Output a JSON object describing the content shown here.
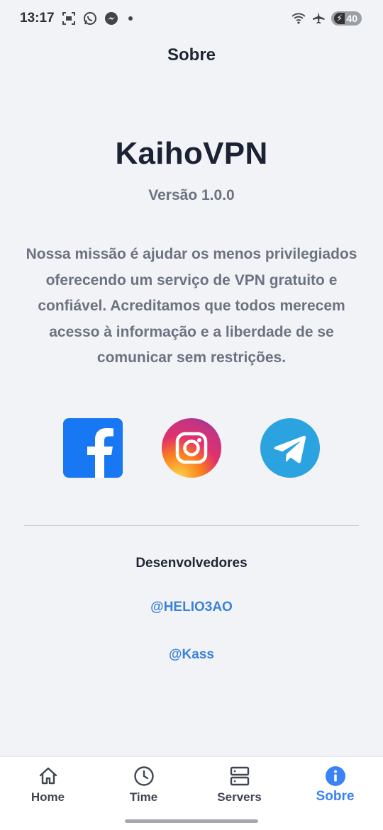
{
  "status_bar": {
    "time": "13:17",
    "battery": "40",
    "icons": [
      "screenshot-icon",
      "whatsapp-icon",
      "messenger-icon",
      "wifi-icon",
      "airplane-icon",
      "battery-icon"
    ]
  },
  "header": {
    "title": "Sobre"
  },
  "app": {
    "name": "KaihoVPN",
    "version": "Versão 1.0.0",
    "mission": "Nossa missão é ajudar os menos privilegiados oferecendo um serviço de VPN gratuito e confiável. Acreditamos que todos merecem acesso à informação e a liberdade de se comunicar sem restrições."
  },
  "socials": [
    {
      "name": "facebook-icon",
      "color": "#1877f2"
    },
    {
      "name": "instagram-icon",
      "color": "#e1306c"
    },
    {
      "name": "telegram-icon",
      "color": "#2aa3e0"
    }
  ],
  "developers": {
    "title": "Desenvolvedores",
    "list": [
      "@HELIO3AO",
      "@Kass"
    ],
    "link_color": "#3b82d6"
  },
  "bottom_nav": {
    "items": [
      {
        "label": "Home",
        "icon": "home-icon"
      },
      {
        "label": "Time",
        "icon": "clock-icon"
      },
      {
        "label": "Servers",
        "icon": "servers-icon"
      },
      {
        "label": "Sobre",
        "icon": "info-icon"
      }
    ],
    "active": "Sobre",
    "active_color": "#3b82f6"
  }
}
